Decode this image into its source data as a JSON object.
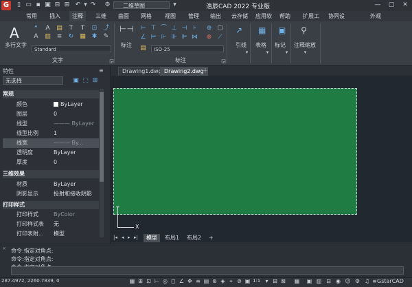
{
  "titlebar": {
    "logo_letter": "G",
    "workspace": "二维草图",
    "title": "浩辰CAD 2022 专业版",
    "controls": [
      "—",
      "▢",
      "✕"
    ]
  },
  "ribbon_tabs": [
    "常用",
    "插入",
    "注释",
    "三维",
    "曲面",
    "网格",
    "视图",
    "管理",
    "输出",
    "云存储",
    "应用软",
    "帮助",
    "扩展工",
    "协同设",
    "外观"
  ],
  "ribbon": {
    "text_panel": {
      "big_label": "多行文字",
      "style_combo": "Standard",
      "panel_label": "文字"
    },
    "dim_panel": {
      "big_label": "标注",
      "style_combo": "ISO-25",
      "panel_label": "标注"
    },
    "leader": {
      "label": "引线"
    },
    "table": {
      "label": "表格"
    },
    "mark": {
      "label": "标记"
    },
    "scale": {
      "label": "注释缩放"
    }
  },
  "props": {
    "title": "特性",
    "selection": "无选择",
    "sections": [
      {
        "name": "常规",
        "rows": [
          {
            "label": "颜色",
            "value": "ByLayer"
          },
          {
            "label": "图层",
            "value": "0"
          },
          {
            "label": "线型",
            "value": "——— ByLayer"
          },
          {
            "label": "线型比例",
            "value": "1"
          },
          {
            "label": "线宽",
            "value": "——— By..."
          },
          {
            "label": "透明度",
            "value": "ByLayer"
          },
          {
            "label": "厚度",
            "value": "0"
          }
        ]
      },
      {
        "name": "三维效果",
        "rows": [
          {
            "label": "材质",
            "value": "ByLayer"
          },
          {
            "label": "阴影显示",
            "value": "投射和接收阴影"
          }
        ]
      },
      {
        "name": "打印样式",
        "rows": [
          {
            "label": "打印样式",
            "value": "ByColor"
          },
          {
            "label": "打印样式表",
            "value": "无"
          },
          {
            "label": "打印表附...",
            "value": "模型"
          }
        ]
      }
    ]
  },
  "doc_tabs": [
    "Drawing1.dwg",
    "Drawing2.dwg"
  ],
  "layout_tabs": [
    "模型",
    "布局1",
    "布局2"
  ],
  "ucs": {
    "x": "X",
    "y": "Y"
  },
  "command_lines": [
    "命令:指定对角点:",
    "命令:指定对角点:",
    "命令:指定对角点:"
  ],
  "status": {
    "coords": "287.4972, 2260.7839, 0",
    "scale": "1:1",
    "brand": "GstarCAD"
  },
  "colors": {
    "drawing_area": "#1f7d43",
    "canvas": "#212830",
    "accent": "#6fb1e6"
  }
}
